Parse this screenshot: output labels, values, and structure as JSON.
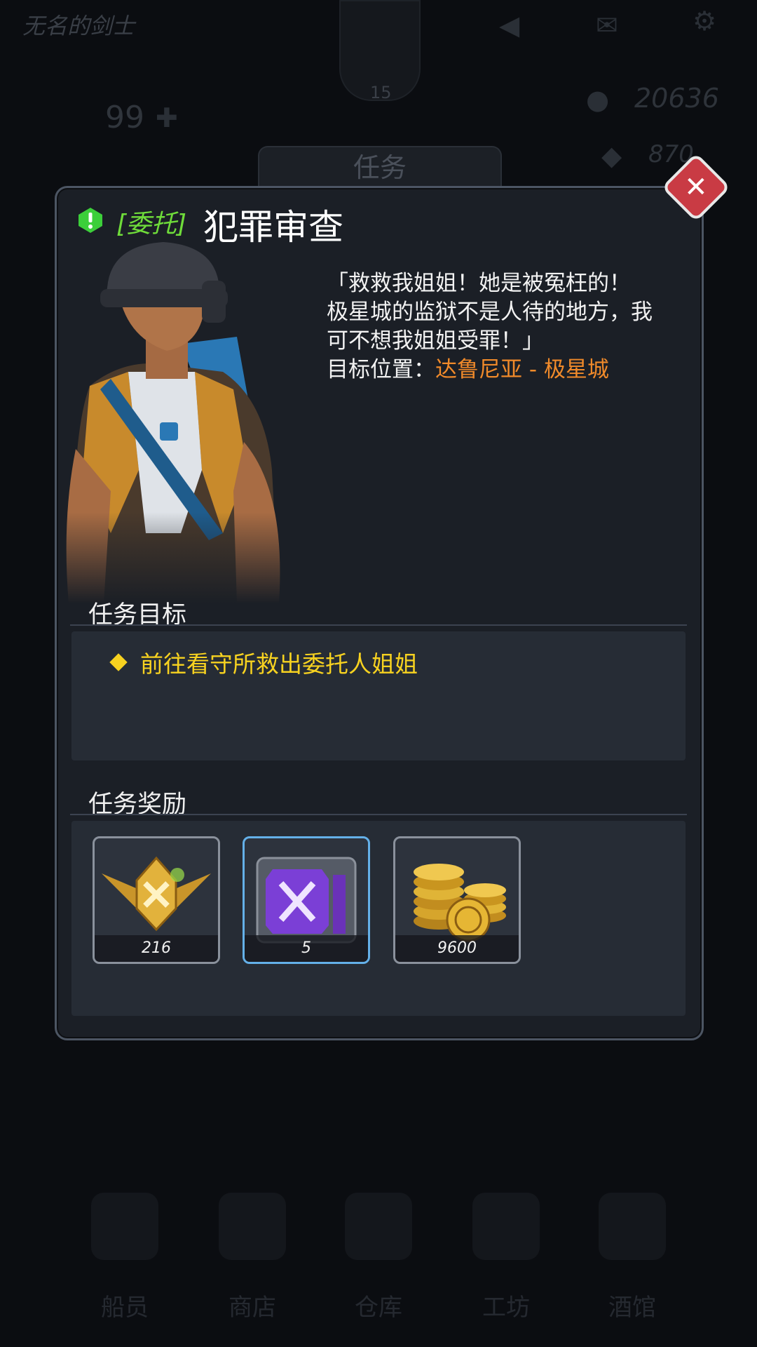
{
  "background": {
    "player_name": "无名的剑士",
    "player_level": "15",
    "stat_value": "99",
    "gold": "20636",
    "gems": "870",
    "tab_title": "任务",
    "nav": [
      {
        "label": "船员"
      },
      {
        "label": "商店"
      },
      {
        "label": "仓库"
      },
      {
        "label": "工坊"
      },
      {
        "label": "酒馆"
      }
    ]
  },
  "quest": {
    "tag": "[委托]",
    "title": "犯罪审查",
    "dialogue_lines": [
      "「救救我姐姐！她是被冤枉的！",
      "极星城的监狱不是人待的地方，我",
      "可不想我姐姐受罪！」"
    ],
    "location_label": "目标位置：",
    "location_value": "达鲁尼亚 - 极星城",
    "objective_header": "任务目标",
    "objective": "前往看守所救出委托人姐姐",
    "reward_header": "任务奖励",
    "rewards": [
      {
        "icon": "medal-icon",
        "count": "216",
        "frame": "gray"
      },
      {
        "icon": "supply-crate-icon",
        "count": "5",
        "frame": "blue"
      },
      {
        "icon": "gold-coins-icon",
        "count": "9600",
        "frame": "gray"
      }
    ]
  },
  "colors": {
    "tag": "#6fdc3a",
    "location": "#f08a2a",
    "objective": "#f7d220",
    "close_button": "#c93b44"
  }
}
